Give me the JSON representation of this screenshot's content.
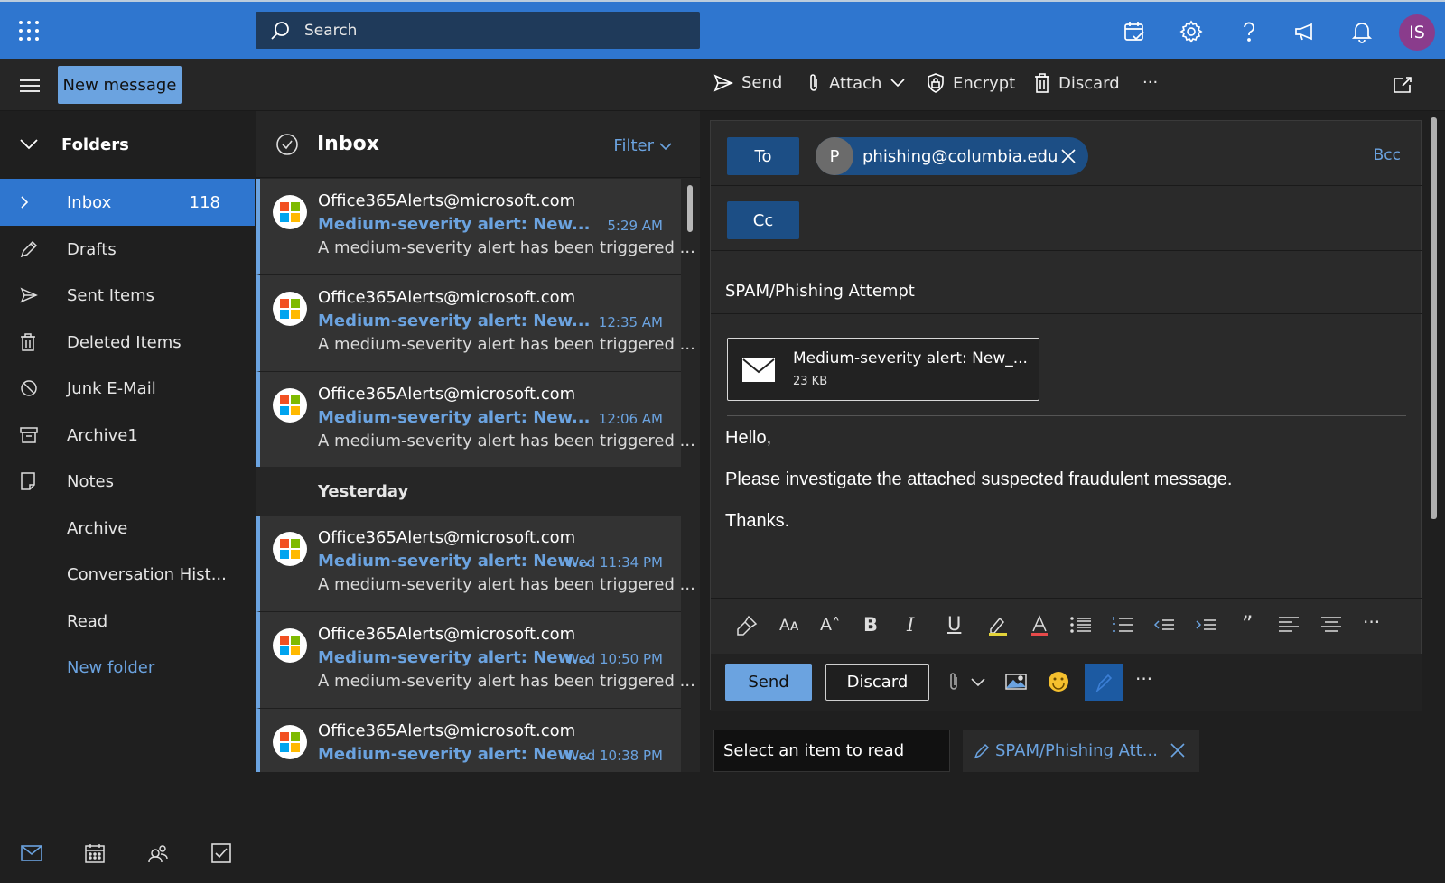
{
  "header": {
    "search_placeholder": "Search",
    "avatar_initials": "IS",
    "accent": "#2f76cf"
  },
  "command_bar": {
    "new_message": "New message",
    "send": "Send",
    "attach": "Attach",
    "encrypt": "Encrypt",
    "discard": "Discard",
    "more": "···"
  },
  "sidebar": {
    "folders_label": "Folders",
    "items": [
      {
        "label": "Inbox",
        "count": "118"
      },
      {
        "label": "Drafts"
      },
      {
        "label": "Sent Items"
      },
      {
        "label": "Deleted Items"
      },
      {
        "label": "Junk E-Mail"
      },
      {
        "label": "Archive1"
      },
      {
        "label": "Notes"
      },
      {
        "label": "Archive"
      },
      {
        "label": "Conversation Hist..."
      },
      {
        "label": "Read"
      },
      {
        "label": "New folder"
      }
    ]
  },
  "message_list": {
    "title": "Inbox",
    "filter": "Filter",
    "day_separator": "Yesterday",
    "messages": [
      {
        "from": "Office365Alerts@microsoft.com",
        "subject": "Medium-severity alert: New...",
        "time": "5:29 AM",
        "preview": "A medium-severity alert has been triggered ..."
      },
      {
        "from": "Office365Alerts@microsoft.com",
        "subject": "Medium-severity alert: New...",
        "time": "12:35 AM",
        "preview": "A medium-severity alert has been triggered ..."
      },
      {
        "from": "Office365Alerts@microsoft.com",
        "subject": "Medium-severity alert: New...",
        "time": "12:06 AM",
        "preview": "A medium-severity alert has been triggered ..."
      },
      {
        "from": "Office365Alerts@microsoft.com",
        "subject": "Medium-severity alert: New...",
        "time": "Wed 11:34 PM",
        "preview": "A medium-severity alert has been triggered ..."
      },
      {
        "from": "Office365Alerts@microsoft.com",
        "subject": "Medium-severity alert: New...",
        "time": "Wed 10:50 PM",
        "preview": "A medium-severity alert has been triggered ..."
      },
      {
        "from": "Office365Alerts@microsoft.com",
        "subject": "Medium-severity alert: New...",
        "time": "Wed 10:38 PM",
        "preview": ""
      }
    ]
  },
  "compose": {
    "to_label": "To",
    "cc_label": "Cc",
    "bcc_label": "Bcc",
    "recipient_initial": "P",
    "recipient": "phishing@columbia.edu",
    "subject": "SPAM/Phishing Attempt",
    "attachment_name": "Medium-severity alert: New_...",
    "attachment_size": "23 KB",
    "body": [
      "Hello,",
      "Please investigate the attached suspected fraudulent message.",
      "Thanks."
    ],
    "send": "Send",
    "discard": "Discard",
    "more": "···"
  },
  "bottom_tabs": {
    "reading": "Select an item to read",
    "draft": "SPAM/Phishing Att..."
  }
}
